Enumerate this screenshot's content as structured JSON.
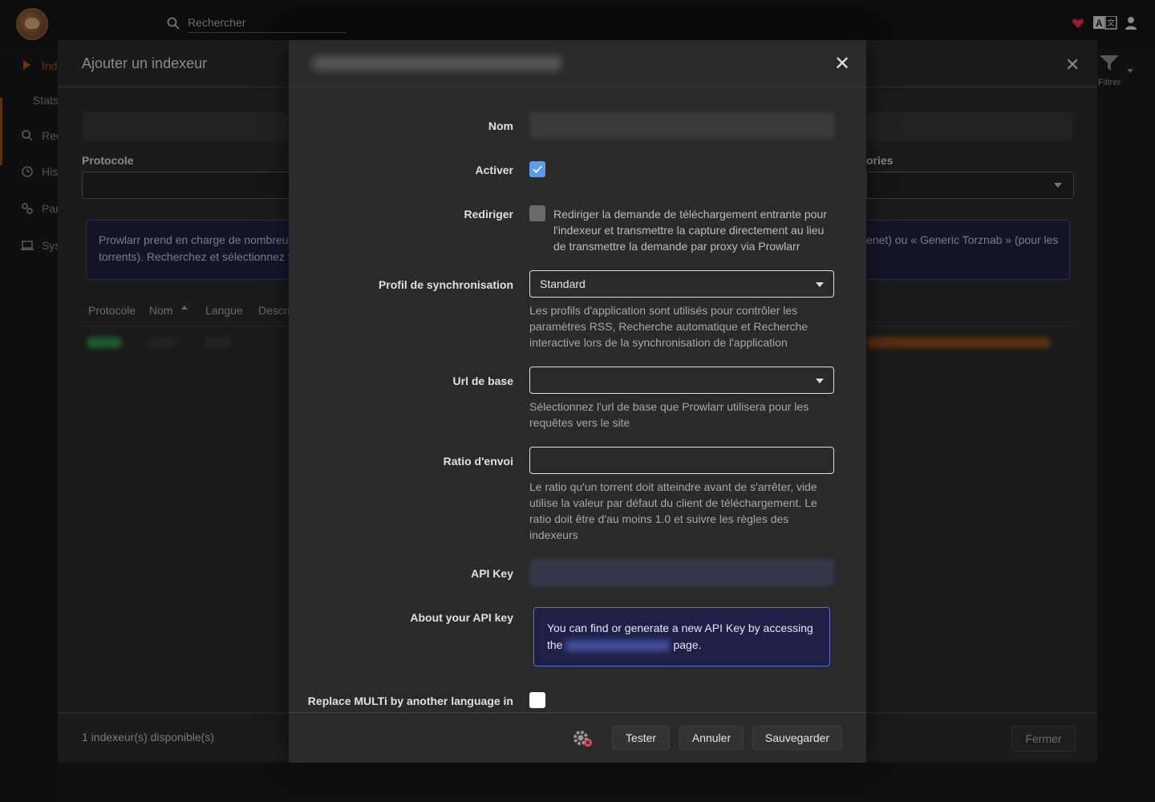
{
  "topbar": {
    "search_placeholder": "Rechercher"
  },
  "sidebar": {
    "items": [
      {
        "label": "Ind",
        "icon": "play-icon"
      },
      {
        "label": "Stats"
      },
      {
        "label": "Rec",
        "icon": "search-icon"
      },
      {
        "label": "His",
        "icon": "history-icon"
      },
      {
        "label": "Par",
        "icon": "settings-icon"
      },
      {
        "label": "Sys",
        "icon": "laptop-icon"
      }
    ]
  },
  "background_modal": {
    "title": "Ajouter un indexeur",
    "protocol_label": "Protocole",
    "categories_label_partial": "ories",
    "info_left": "Prowlarr prend en charge de nombreux",
    "info_left2": "torrents). Recherchez et sélectionnez v",
    "info_right": "enet) ou « Generic Torznab » (pour les",
    "table_headers": [
      "Protocole",
      "Nom",
      "Langue",
      "Descri"
    ],
    "filter_label": "Filtrer",
    "footer_count": "1 indexeur(s) disponible(s)",
    "close_button": "Fermer"
  },
  "modal": {
    "fields": {
      "nom_label": "Nom",
      "activer_label": "Activer",
      "activer_checked": true,
      "rediriger_label": "Rediriger",
      "rediriger_help": "Rediriger la demande de téléchargement entrante pour l'indexeur et transmettre la capture directement au lieu de transmettre la demande par proxy via Prowlarr",
      "profil_label": "Profil de synchronisation",
      "profil_value": "Standard",
      "profil_help": "Les profils d'application sont utilisés pour contrôler les paramètres RSS, Recherche automatique et Recherche interactive lors de la synchronisation de l'application",
      "url_label": "Url de base",
      "url_value": "",
      "url_help": "Sélectionnez l'url de base que Prowlarr utilisera pour les requêtes vers le site",
      "ratio_label": "Ratio d'envoi",
      "ratio_value": "",
      "ratio_help": "Le ratio qu'un torrent doit atteindre avant de s'arrêter, vide utilise la valeur par défaut du client de téléchargement. Le ratio doit être d'au moins 1.0 et suivre les règles des indexeurs",
      "apikey_label": "API Key",
      "about_label": "About your API key",
      "about_text_1": "You can find or generate a new API Key by accessing",
      "about_text_2a": "the",
      "about_text_2b": "page.",
      "multi_label": "Replace MULTi by another language in"
    },
    "buttons": {
      "test": "Tester",
      "cancel": "Annuler",
      "save": "Sauvegarder"
    },
    "colors": {
      "accent": "#5d9cec",
      "info_bg": "#1f2048",
      "info_border": "#5d6fd8"
    }
  }
}
